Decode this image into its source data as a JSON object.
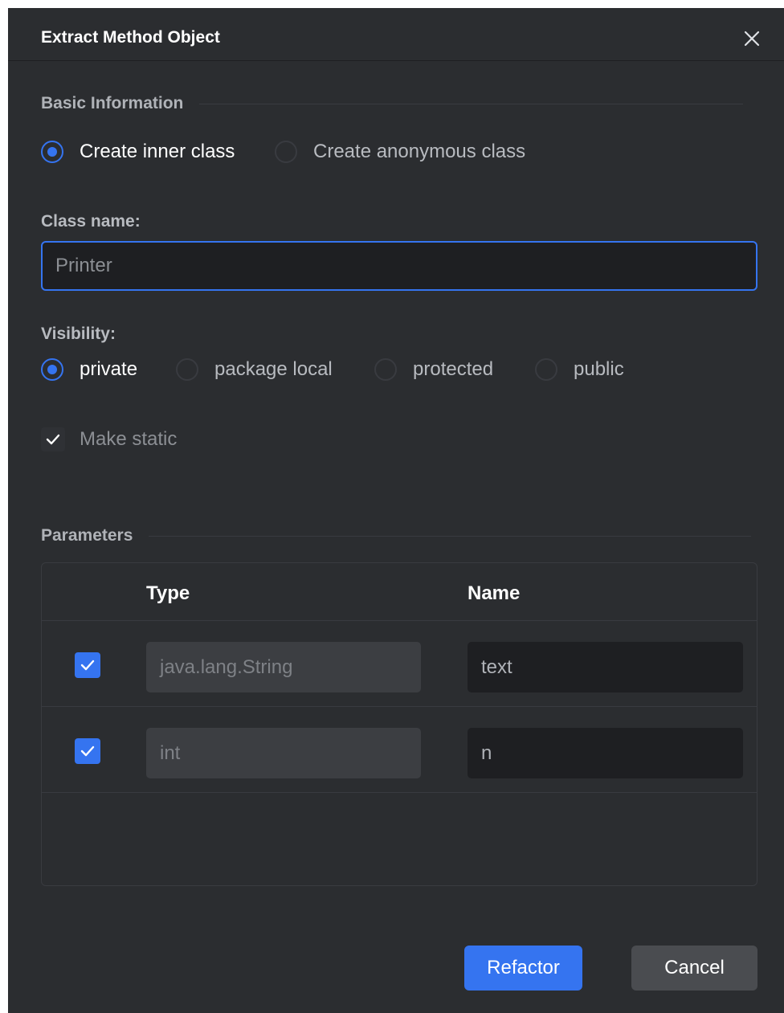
{
  "dialog": {
    "title": "Extract Method Object",
    "close_icon": "close-icon"
  },
  "basic_info": {
    "header": "Basic Information",
    "options": [
      {
        "label": "Create inner class",
        "checked": true
      },
      {
        "label": "Create anonymous class",
        "checked": false
      }
    ]
  },
  "class_name": {
    "label": "Class name:",
    "value": "Printer"
  },
  "visibility": {
    "label": "Visibility:",
    "options": [
      {
        "label": "private",
        "checked": true
      },
      {
        "label": "package local",
        "checked": false
      },
      {
        "label": "protected",
        "checked": false
      },
      {
        "label": "public",
        "checked": false
      }
    ]
  },
  "make_static": {
    "label": "Make static",
    "checked": true
  },
  "parameters": {
    "header": "Parameters",
    "columns": [
      "Type",
      "Name"
    ],
    "rows": [
      {
        "checked": true,
        "type": "java.lang.String",
        "name": "text"
      },
      {
        "checked": true,
        "type": "int",
        "name": "n"
      }
    ]
  },
  "buttons": {
    "refactor": "Refactor",
    "cancel": "Cancel"
  },
  "colors": {
    "accent": "#3574f0",
    "background": "#2b2d30",
    "input_background": "#1e1f22"
  }
}
